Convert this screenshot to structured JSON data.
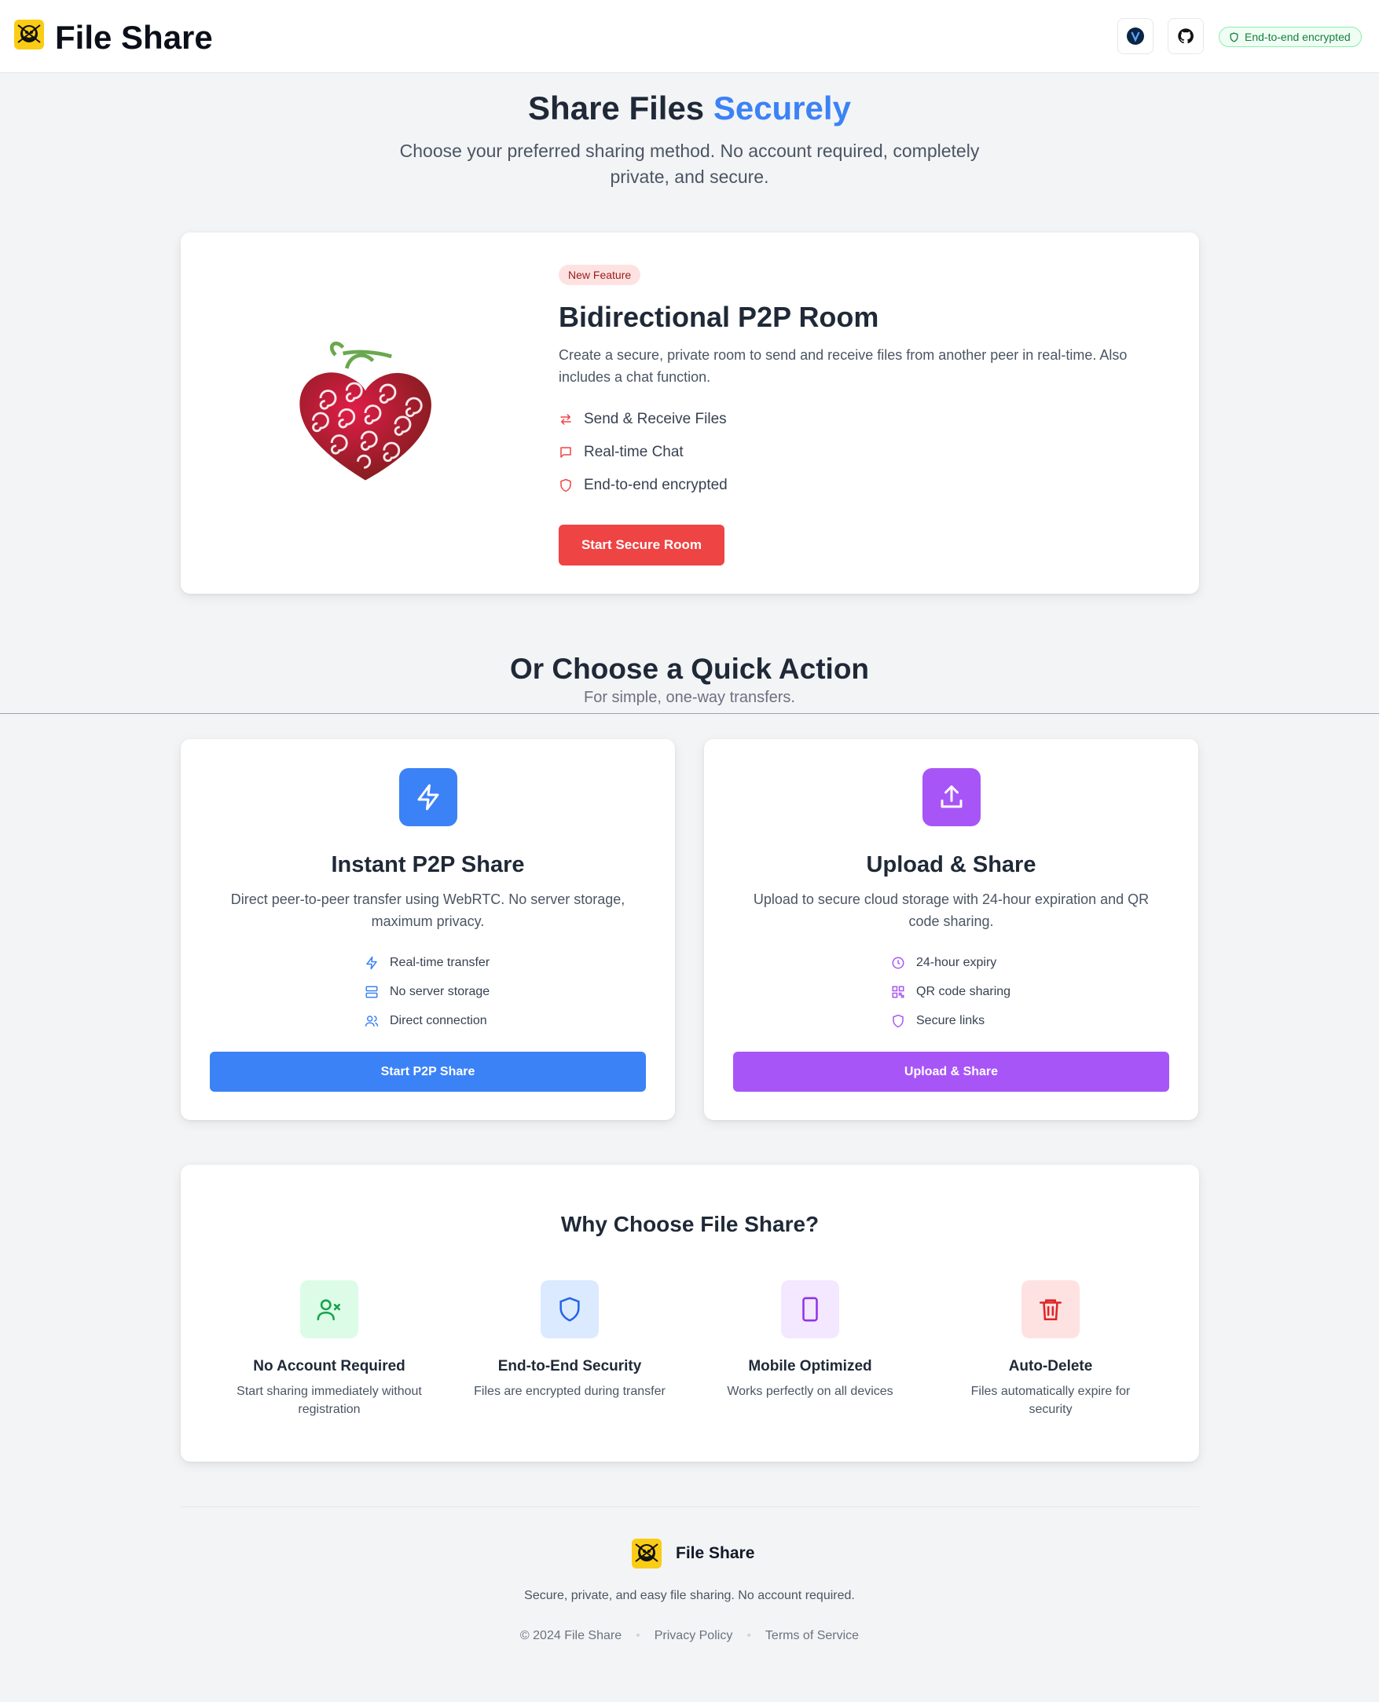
{
  "header": {
    "brand": "File Share",
    "vercel_button_icon": "v-badge-icon",
    "github_button_icon": "github-icon",
    "encryption_badge": "End-to-end encrypted"
  },
  "hero": {
    "title_prefix": "Share Files ",
    "title_accent": "Securely",
    "subtitle": "Choose your preferred sharing method. No account required, completely private, and secure."
  },
  "room": {
    "badge": "New Feature",
    "title": "Bidirectional P2P Room",
    "description": "Create a secure, private room to send and receive files from another peer in real-time. Also includes a chat function.",
    "features": [
      {
        "icon": "arrows-swap-icon",
        "label": "Send & Receive Files"
      },
      {
        "icon": "chat-icon",
        "label": "Real-time Chat"
      },
      {
        "icon": "shield-icon",
        "label": "End-to-end encrypted"
      }
    ],
    "button": "Start Secure Room"
  },
  "quick": {
    "title": "Or Choose a Quick Action",
    "subtitle": "For simple, one-way transfers."
  },
  "p2p": {
    "icon": "bolt-icon",
    "title": "Instant P2P Share",
    "description": "Direct peer-to-peer transfer using WebRTC. No server storage, maximum privacy.",
    "features": [
      {
        "icon": "bolt-icon",
        "label": "Real-time transfer"
      },
      {
        "icon": "server-icon",
        "label": "No server storage"
      },
      {
        "icon": "users-icon",
        "label": "Direct connection"
      }
    ],
    "button": "Start P2P Share",
    "accent": "#3b82f6"
  },
  "upload": {
    "icon": "upload-icon",
    "title": "Upload & Share",
    "description": "Upload to secure cloud storage with 24-hour expiration and QR code sharing.",
    "features": [
      {
        "icon": "clock-icon",
        "label": "24-hour expiry"
      },
      {
        "icon": "qr-code-icon",
        "label": "QR code sharing"
      },
      {
        "icon": "shield-icon",
        "label": "Secure links"
      }
    ],
    "button": "Upload & Share",
    "accent": "#a855f7"
  },
  "why": {
    "title": "Why Choose File Share?",
    "items": [
      {
        "icon": "user-x-icon",
        "name": "No Account Required",
        "desc": "Start sharing immediately without registration"
      },
      {
        "icon": "shield-icon",
        "name": "End-to-End Security",
        "desc": "Files are encrypted during transfer"
      },
      {
        "icon": "smartphone-icon",
        "name": "Mobile Optimized",
        "desc": "Works perfectly on all devices"
      },
      {
        "icon": "trash-icon",
        "name": "Auto-Delete",
        "desc": "Files automatically expire for security"
      }
    ]
  },
  "footer": {
    "brand": "File Share",
    "tagline": "Secure, private, and easy file sharing. No account required.",
    "copyright": "© 2024 File Share",
    "privacy": "Privacy Policy",
    "terms": "Terms of Service"
  }
}
